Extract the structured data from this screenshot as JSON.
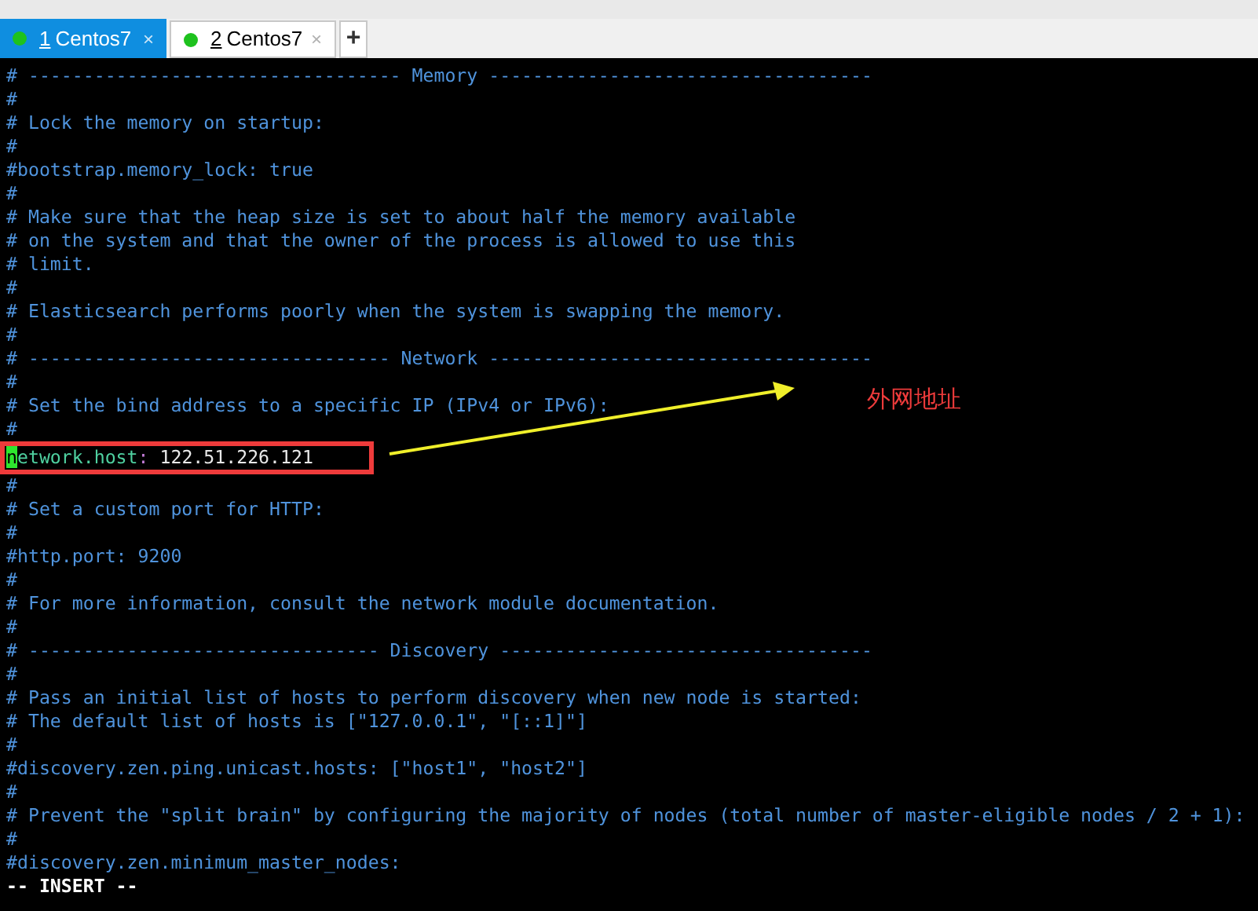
{
  "tabs": [
    {
      "number": "1",
      "label": "Centos7",
      "close": "×",
      "selected": true,
      "color": "#1ec21e"
    },
    {
      "number": "2",
      "label": "Centos7",
      "close": "×",
      "selected": false,
      "color": "#1ec21e"
    }
  ],
  "new_tab": "+",
  "terminal": {
    "lines": [
      {
        "kind": "comment",
        "text": "# ---------------------------------- Memory -----------------------------------"
      },
      {
        "kind": "comment",
        "text": "#"
      },
      {
        "kind": "comment",
        "text": "# Lock the memory on startup:"
      },
      {
        "kind": "comment",
        "text": "#"
      },
      {
        "kind": "comment",
        "text": "#bootstrap.memory_lock: true"
      },
      {
        "kind": "comment",
        "text": "#"
      },
      {
        "kind": "comment",
        "text": "# Make sure that the heap size is set to about half the memory available"
      },
      {
        "kind": "comment",
        "text": "# on the system and that the owner of the process is allowed to use this"
      },
      {
        "kind": "comment",
        "text": "# limit."
      },
      {
        "kind": "comment",
        "text": "#"
      },
      {
        "kind": "comment",
        "text": "# Elasticsearch performs poorly when the system is swapping the memory."
      },
      {
        "kind": "comment",
        "text": "#"
      },
      {
        "kind": "comment",
        "text": "# --------------------------------- Network -----------------------------------"
      },
      {
        "kind": "comment",
        "text": "#"
      },
      {
        "kind": "comment",
        "text": "# Set the bind address to a specific IP (IPv4 or IPv6):"
      },
      {
        "kind": "comment",
        "text": "#"
      },
      {
        "kind": "setting",
        "key": "network.host",
        "separator": ":",
        "value": "122.51.226.121",
        "cursor": true
      },
      {
        "kind": "comment",
        "text": "#"
      },
      {
        "kind": "comment",
        "text": "# Set a custom port for HTTP:"
      },
      {
        "kind": "comment",
        "text": "#"
      },
      {
        "kind": "comment",
        "text": "#http.port: 9200"
      },
      {
        "kind": "comment",
        "text": "#"
      },
      {
        "kind": "comment",
        "text": "# For more information, consult the network module documentation."
      },
      {
        "kind": "comment",
        "text": "#"
      },
      {
        "kind": "comment",
        "text": "# -------------------------------- Discovery ----------------------------------"
      },
      {
        "kind": "comment",
        "text": "#"
      },
      {
        "kind": "comment",
        "text": "# Pass an initial list of hosts to perform discovery when new node is started:"
      },
      {
        "kind": "comment",
        "text": "# The default list of hosts is [\"127.0.0.1\", \"[::1]\"]"
      },
      {
        "kind": "comment",
        "text": "#"
      },
      {
        "kind": "comment",
        "text": "#discovery.zen.ping.unicast.hosts: [\"host1\", \"host2\"]"
      },
      {
        "kind": "comment",
        "text": "#"
      },
      {
        "kind": "comment",
        "text": "# Prevent the \"split brain\" by configuring the majority of nodes (total number of master-eligible nodes / 2 + 1):"
      },
      {
        "kind": "comment",
        "text": "#"
      },
      {
        "kind": "comment",
        "text": "#discovery.zen.minimum_master_nodes:"
      }
    ],
    "mode": "-- INSERT --"
  },
  "annotation": {
    "label": "外网地址"
  }
}
